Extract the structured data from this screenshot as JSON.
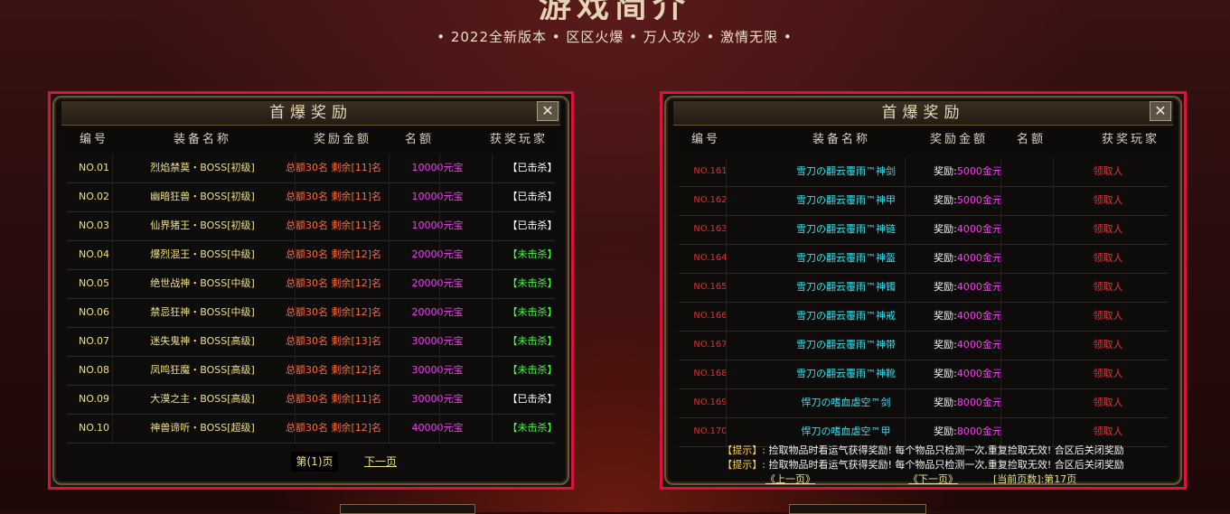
{
  "header": {
    "title": "游戏简介",
    "subtitle": "• 2022全新版本 • 区区火爆 • 万人攻沙 • 激情无限 •"
  },
  "left_panel": {
    "title": "首爆奖励",
    "close_label": "✕",
    "columns": [
      "编号",
      "装备名称",
      "奖励金额",
      "名额",
      "获奖玩家"
    ],
    "rows": [
      {
        "no": "NO.01",
        "name": "烈焰禁莫・BOSS[初级]",
        "quota": "总额30名 剩余[11]名",
        "amount": "10000元宝",
        "status": "【已击杀】",
        "killed": true
      },
      {
        "no": "NO.02",
        "name": "幽暗狂兽・BOSS[初级]",
        "quota": "总额30名 剩余[11]名",
        "amount": "10000元宝",
        "status": "【已击杀】",
        "killed": true
      },
      {
        "no": "NO.03",
        "name": "仙界猪王・BOSS[初级]",
        "quota": "总额30名 剩余[11]名",
        "amount": "10000元宝",
        "status": "【已击杀】",
        "killed": true
      },
      {
        "no": "NO.04",
        "name": "爆烈混王・BOSS[中级]",
        "quota": "总额30名 剩余[12]名",
        "amount": "20000元宝",
        "status": "【未击杀】",
        "killed": false
      },
      {
        "no": "NO.05",
        "name": "绝世战神・BOSS[中级]",
        "quota": "总额30名 剩余[12]名",
        "amount": "20000元宝",
        "status": "【未击杀】",
        "killed": false
      },
      {
        "no": "NO.06",
        "name": "禁忌狂神・BOSS[中级]",
        "quota": "总额30名 剩余[12]名",
        "amount": "20000元宝",
        "status": "【未击杀】",
        "killed": false
      },
      {
        "no": "NO.07",
        "name": "迷失鬼神・BOSS[高级]",
        "quota": "总额30名 剩余[13]名",
        "amount": "30000元宝",
        "status": "【未击杀】",
        "killed": false
      },
      {
        "no": "NO.08",
        "name": "凤鸣狂魔・BOSS[高级]",
        "quota": "总额30名 剩余[12]名",
        "amount": "30000元宝",
        "status": "【未击杀】",
        "killed": false
      },
      {
        "no": "NO.09",
        "name": "大漠之主・BOSS[高级]",
        "quota": "总额30名 剩余[11]名",
        "amount": "30000元宝",
        "status": "【已击杀】",
        "killed": true
      },
      {
        "no": "NO.10",
        "name": "神兽谛听・BOSS[超级]",
        "quota": "总额30名 剩余[12]名",
        "amount": "40000元宝",
        "status": "【未击杀】",
        "killed": false
      }
    ],
    "pager": {
      "current": "第(1)页",
      "next": "下一页"
    }
  },
  "right_panel": {
    "title": "首爆奖励",
    "close_label": "✕",
    "columns": [
      "编号",
      "装备名称",
      "奖励金额",
      "名额",
      "获奖玩家"
    ],
    "rows": [
      {
        "no": "NO.161",
        "name": "雪刀の翻云覆雨™神剑",
        "label": "奖励:",
        "amount": "5000金元",
        "player": "领取人"
      },
      {
        "no": "NO.162",
        "name": "雪刀の翻云覆雨™神甲",
        "label": "奖励:",
        "amount": "5000金元",
        "player": "领取人"
      },
      {
        "no": "NO.163",
        "name": "雪刀の翻云覆雨™神链",
        "label": "奖励:",
        "amount": "4000金元",
        "player": "领取人"
      },
      {
        "no": "NO.164",
        "name": "雪刀の翻云覆雨™神盔",
        "label": "奖励:",
        "amount": "4000金元",
        "player": "领取人"
      },
      {
        "no": "NO.165",
        "name": "雪刀の翻云覆雨™神镯",
        "label": "奖励:",
        "amount": "4000金元",
        "player": "领取人"
      },
      {
        "no": "NO.166",
        "name": "雪刀の翻云覆雨™神戒",
        "label": "奖励:",
        "amount": "4000金元",
        "player": "领取人"
      },
      {
        "no": "NO.167",
        "name": "雪刀の翻云覆雨™神带",
        "label": "奖励:",
        "amount": "4000金元",
        "player": "领取人"
      },
      {
        "no": "NO.168",
        "name": "雪刀の翻云覆雨™神靴",
        "label": "奖励:",
        "amount": "4000金元",
        "player": "领取人"
      },
      {
        "no": "NO.169",
        "name": "悍刀の嗜血虐空™剑",
        "label": "奖励:",
        "amount": "8000金元",
        "player": "领取人"
      },
      {
        "no": "NO.170",
        "name": "悍刀の嗜血虐空™甲",
        "label": "奖励:",
        "amount": "8000金元",
        "player": "领取人"
      }
    ],
    "tips": [
      {
        "key": "【提示】:",
        "text": "捡取物品时看运气获得奖励! 每个物品只检测一次,重复捡取无效! 合区后关闭奖励"
      },
      {
        "key": "【提示】:",
        "text": "捡取物品时看运气获得奖励! 每个物品只检测一次,重复捡取无效! 合区后关闭奖励"
      }
    ],
    "pager": {
      "prev": "《上一页》",
      "next": "《下一页》",
      "current": "[当前页数]:第17页"
    }
  }
}
